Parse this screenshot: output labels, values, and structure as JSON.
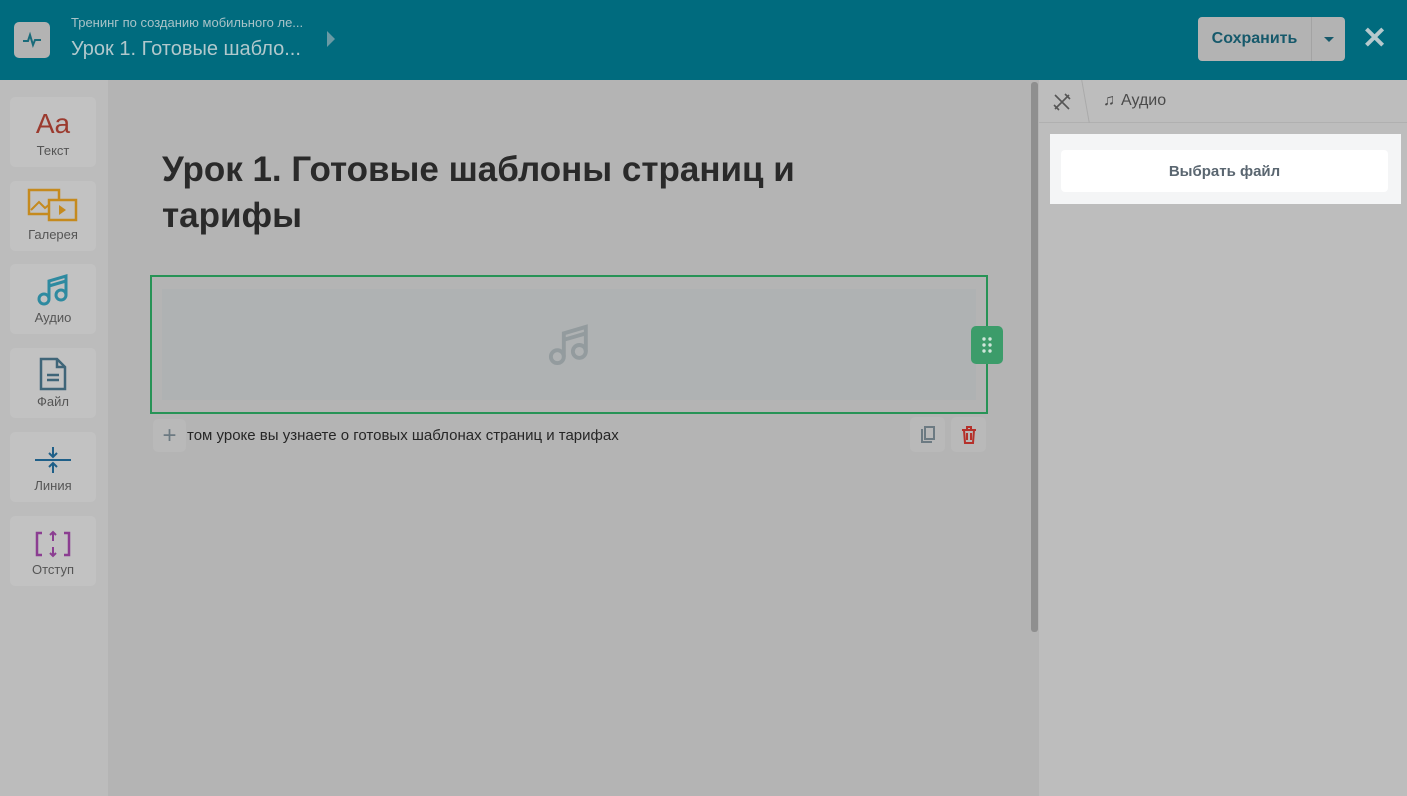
{
  "header": {
    "course": "Тренинг по созданию мобильного ле...",
    "lesson": "Урок 1. Готовые шабло...",
    "save_label": "Сохранить"
  },
  "tools": [
    {
      "label": "Текст",
      "glyph": "Aa"
    },
    {
      "label": "Галерея"
    },
    {
      "label": "Аудио"
    },
    {
      "label": "Файл"
    },
    {
      "label": "Линия"
    },
    {
      "label": "Отступ"
    }
  ],
  "canvas": {
    "title": "Урок 1. Готовые шаблоны страниц и тарифы",
    "description": "том уроке вы узнаете о готовых шаблонах страниц и тарифах"
  },
  "panel": {
    "breadcrumb": "Аудио",
    "choose_file": "Выбрать файл"
  },
  "colors": {
    "header": "#006b7e",
    "accent": "#279356"
  }
}
